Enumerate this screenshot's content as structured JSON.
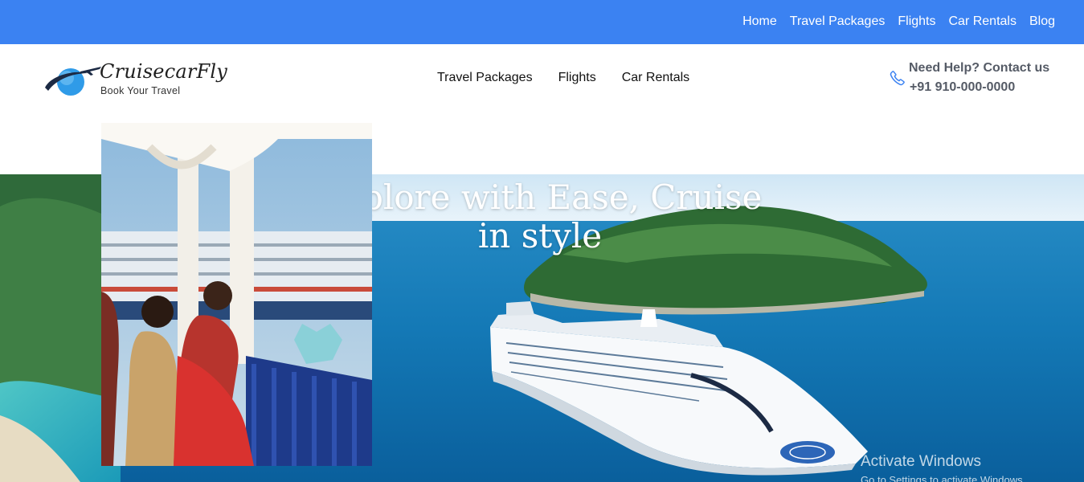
{
  "topbar": {
    "color": "#3b82f2",
    "links": [
      "Home",
      "Travel Packages",
      "Flights",
      "Car Rentals",
      "Blog"
    ]
  },
  "header": {
    "brand": {
      "name": "CruisecarFly",
      "tagline": "Book Your Travel",
      "icon": "plane-globe-logo"
    },
    "nav": [
      "Travel Packages",
      "Flights",
      "Car Rentals"
    ],
    "help": {
      "icon": "phone-icon",
      "title": "Need Help? Contact us",
      "phone": "+91 910-000-0000"
    }
  },
  "hero": {
    "title": "Explore with Ease, Cruise in style",
    "background": "cruise-ship-island-sea-photo",
    "overlay_photo": "friends-on-cruise-deck-photo"
  },
  "watermark": {
    "title": "Activate Windows",
    "subtitle": "Go to Settings to activate Windows."
  }
}
